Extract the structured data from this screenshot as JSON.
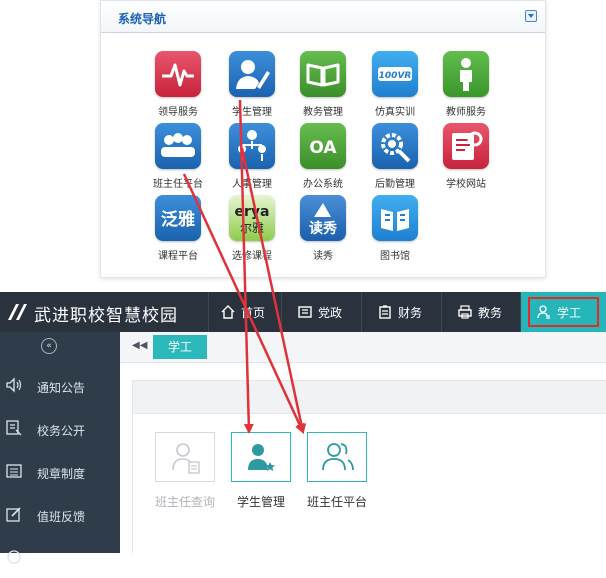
{
  "system_nav": {
    "title": "系统导航",
    "apps": [
      {
        "label": "领导服务",
        "icon": "heartbeat-icon",
        "color": "#d9324b"
      },
      {
        "label": "学生管理",
        "icon": "student-pen-icon",
        "color": "#1f73c4"
      },
      {
        "label": "教务管理",
        "icon": "open-book-icon",
        "color": "#4aa436"
      },
      {
        "label": "仿真实训",
        "icon": "vr-icon",
        "color": "#1f8fdd",
        "badge": "100VR"
      },
      {
        "label": "教师服务",
        "icon": "teacher-icon",
        "color": "#47ad3c"
      },
      {
        "label": "班主任平台",
        "icon": "group-icon",
        "color": "#1f73c4"
      },
      {
        "label": "人事管理",
        "icon": "people-org-icon",
        "color": "#1f73c4"
      },
      {
        "label": "办公系统",
        "icon": "oa-icon",
        "color": "#4aa436",
        "badge": "OA"
      },
      {
        "label": "后勤管理",
        "icon": "gear-search-icon",
        "color": "#1f73c4"
      },
      {
        "label": "学校网站",
        "icon": "website-icon",
        "color": "#d9324b"
      },
      {
        "label": "课程平台",
        "icon": "fanya-icon",
        "color": "#1f73c4",
        "badge": "泛雅"
      },
      {
        "label": "选修课程",
        "icon": "erya-icon",
        "color": "#73bf31",
        "badge": "erya",
        "badge2": "尔雅"
      },
      {
        "label": "读秀",
        "icon": "duxiu-icon",
        "color": "#1f6fbe",
        "badge": "读秀"
      },
      {
        "label": "图书馆",
        "icon": "library-icon",
        "color": "#1f8fdd"
      }
    ]
  },
  "app": {
    "title": "武进职校智慧校园",
    "tabs": [
      {
        "label": "首页",
        "icon": "home-icon"
      },
      {
        "label": "党政",
        "icon": "id-card-icon"
      },
      {
        "label": "财务",
        "icon": "clipboard-icon"
      },
      {
        "label": "教务",
        "icon": "printer-icon"
      },
      {
        "label": "学工",
        "icon": "user-icon",
        "active": true
      }
    ],
    "sidebar": {
      "toggle": "«",
      "items": [
        {
          "label": "通知公告",
          "icon": "speaker-icon"
        },
        {
          "label": "校务公开",
          "icon": "doc-list-icon"
        },
        {
          "label": "规章制度",
          "icon": "list-icon"
        },
        {
          "label": "值班反馈",
          "icon": "edit-icon"
        }
      ]
    },
    "breadcrumb": {
      "back": "◀◀",
      "tab": "学工"
    },
    "tiles": [
      {
        "label": "班主任查询",
        "icon": "user-card-icon",
        "disabled": true
      },
      {
        "label": "学生管理",
        "icon": "user-star-icon"
      },
      {
        "label": "班主任平台",
        "icon": "users-icon"
      }
    ]
  },
  "colors": {
    "accent": "#26b6b9",
    "topbar": "#2a323d",
    "sidebar": "#2f3c4a",
    "arrow": "#e0323a"
  }
}
